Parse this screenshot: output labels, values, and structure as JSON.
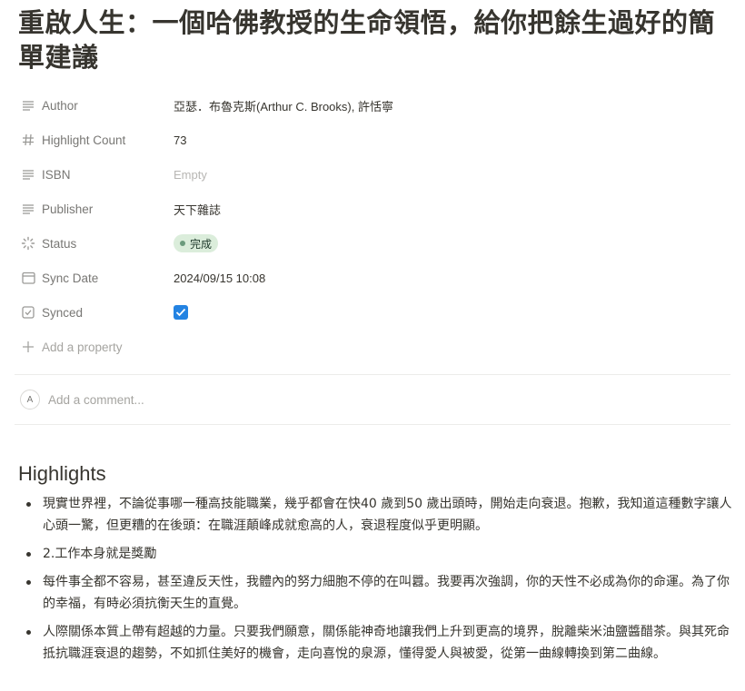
{
  "page": {
    "title": "重啟人生：一個哈佛教授的生命領悟，給你把餘生過好的簡單建議"
  },
  "properties": [
    {
      "label": "Author",
      "icon": "text-lines-icon",
      "value": "亞瑟．布魯克斯(Arthur C. Brooks), 許恬寧",
      "kind": "text"
    },
    {
      "label": "Highlight Count",
      "icon": "hash-icon",
      "value": "73",
      "kind": "text"
    },
    {
      "label": "ISBN",
      "icon": "text-lines-icon",
      "value": "Empty",
      "kind": "empty"
    },
    {
      "label": "Publisher",
      "icon": "text-lines-icon",
      "value": "天下雜誌",
      "kind": "text"
    },
    {
      "label": "Status",
      "icon": "status-spinner-icon",
      "value": "完成",
      "kind": "status",
      "color": "#dbeddb"
    },
    {
      "label": "Sync Date",
      "icon": "calendar-icon",
      "value": "2024/09/15 10:08",
      "kind": "text"
    },
    {
      "label": "Synced",
      "icon": "checkbox-icon",
      "value": "checked",
      "kind": "checkbox",
      "color": "#2383e2"
    }
  ],
  "add_property": {
    "label": "Add a property",
    "icon": "plus-icon"
  },
  "comment": {
    "avatar": "A",
    "placeholder": "Add a comment..."
  },
  "highlights": {
    "heading": "Highlights",
    "items": [
      "現實世界裡，不論從事哪一種高技能職業，幾乎都會在快40 歲到50 歲出頭時，開始走向衰退。抱歉，我知道這種數字讓人心頭一驚，但更糟的在後頭：在職涯顛峰成就愈高的人，衰退程度似乎更明顯。",
      "2.工作本身就是獎勵",
      "每件事全都不容易，甚至違反天性，我體內的努力細胞不停的在叫囂。我要再次強調，你的天性不必成為你的命運。為了你的幸福，有時必須抗衡天生的直覺。",
      "人際關係本質上帶有超越的力量。只要我們願意，關係能神奇地讓我們上升到更高的境界，脫離柴米油鹽醬醋茶。與其死命抵抗職涯衰退的趨勢，不如抓住美好的機會，走向喜悅的泉源，懂得愛人與被愛，從第一曲線轉換到第二曲線。"
    ]
  }
}
